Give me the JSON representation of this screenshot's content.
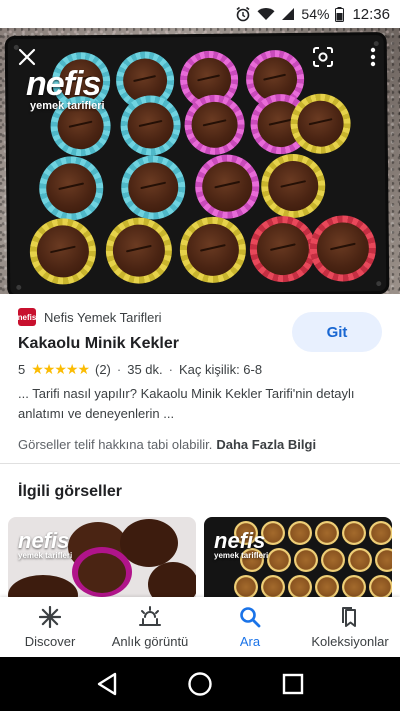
{
  "status_bar": {
    "battery": "54%",
    "time": "12:36"
  },
  "hero": {
    "logo_main": "nefis",
    "logo_sub": "yemek tarifleri"
  },
  "info": {
    "source_name": "Nefis Yemek Tarifleri",
    "source_logo_text": "nefis",
    "visit_button": "Git",
    "title": "Kakaolu Minik Kekler",
    "rating": "5",
    "stars_value": 5,
    "review_count": "(2)",
    "duration": "35 dk.",
    "servings": "Kaç kişilik: 6-8",
    "description": "... Tarifi nasıl yapılır? Kakaolu Minik Kekler Tarifi'nin detaylı anlatımı ve deneyenlerin ...",
    "copyright": "Görseller telif hakkına tabi olabilir.",
    "more_info": "Daha Fazla Bilgi"
  },
  "related": {
    "title": "İlgili görseller",
    "thumbs": [
      {
        "logo_main": "nefis",
        "logo_sub": "yemek tarifleri"
      },
      {
        "logo_main": "nefis",
        "logo_sub": "yemek tarifleri"
      }
    ]
  },
  "bottom_nav": [
    {
      "label": "Discover",
      "icon": "asterisk-icon",
      "active": false
    },
    {
      "label": "Anlık görüntü",
      "icon": "snapshot-icon",
      "active": false
    },
    {
      "label": "Ara",
      "icon": "search-icon",
      "active": true
    },
    {
      "label": "Koleksiyonlar",
      "icon": "collections-icon",
      "active": false
    }
  ],
  "colors": {
    "accent": "#1a73e8",
    "star": "#fbbc04",
    "git_bg": "#e8f0fe",
    "brand_red": "#c8102e"
  }
}
